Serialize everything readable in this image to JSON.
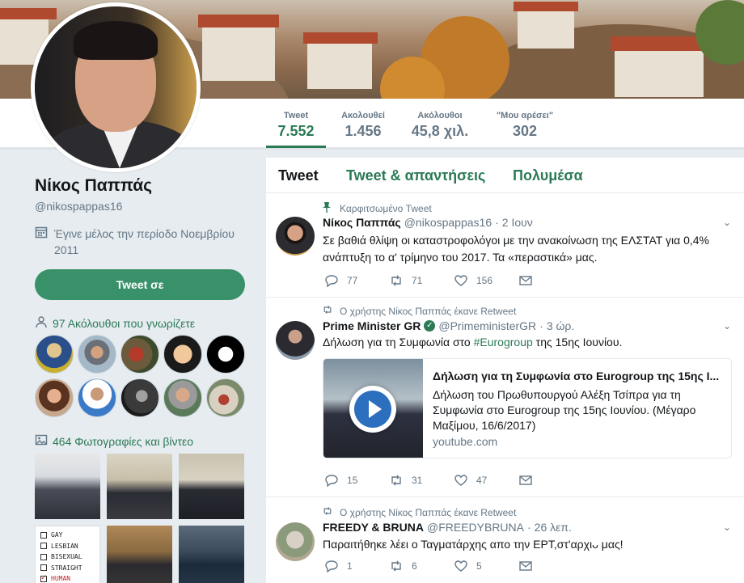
{
  "profile": {
    "name": "Νίκος Παππάς",
    "handle": "@nikospappas16",
    "joined": "Έγινε μέλος την περίοδο Νοεμβρίου 2011",
    "tweet_to_label": "Tweet σε",
    "followers_you_know": "97 Ακόλουθοι που γνωρίζετε",
    "photos_videos": "464 Φωτογραφίες και βίντεο"
  },
  "stats": [
    {
      "label": "Tweet",
      "value": "7.552"
    },
    {
      "label": "Ακολουθεί",
      "value": "1.456"
    },
    {
      "label": "Ακόλουθοι",
      "value": "45,8 χιλ."
    },
    {
      "label": "\"Μου αρέσει\"",
      "value": "302"
    }
  ],
  "tabs": [
    "Tweet",
    "Tweet & απαντήσεις",
    "Πολυμέσα"
  ],
  "thumb_list": [
    "GAY",
    "LESBIAN",
    "BISEXUAL",
    "STRAIGHT",
    "HUMAN"
  ],
  "tweets": [
    {
      "context": "Καρφιτσωμένο Tweet",
      "name": "Νίκος Παππάς",
      "handle": "@nikospappas16",
      "time": "2 Ιουν",
      "text": "Σε βαθιά θλίψη οι καταστροφολόγοι με την ανακοίνωση της ΕΛΣΤΑΤ για 0,4% ανάπτυξη το α' τρίμηνο του 2017. Τα «περαστικά» μας.",
      "replies": "77",
      "retweets": "71",
      "likes": "156"
    },
    {
      "context": "Ο χρήστης Νίκος Παππάς έκανε Retweet",
      "name": "Prime Minister GR",
      "handle": "@PrimeministerGR",
      "time": "3 ώρ.",
      "text_before": "Δήλωση για τη Συμφωνία στο ",
      "hashtag": "#Eurogroup",
      "text_after": " της 15ης Ιουνίου.",
      "card_title": "Δήλωση για τη Συμφωνία στο Eurogroup της 15ης Ι...",
      "card_desc": "Δήλωση του Πρωθυπουργού Αλέξη Τσίπρα για τη Συμφωνία στο Eurogroup της 15ης Ιουνίου. (Μέγαρο Μαξίμου, 16/6/2017)",
      "card_url": "youtube.com",
      "replies": "15",
      "retweets": "31",
      "likes": "47"
    },
    {
      "context": "Ο χρήστης Νίκος Παππάς έκανε Retweet",
      "name": "FREEDY & BRUNA",
      "handle": "@FREEDYBRUNA",
      "time": "26 λεπ.",
      "text": "Παραιτήθηκε λέει ο Ταγματάρχης απο την ΕΡΤ,στ'αρχιᴗ   μας!",
      "replies": "1",
      "retweets": "6",
      "likes": "5"
    }
  ],
  "icons": {
    "pin": "pin-icon",
    "retweet": "retweet-icon",
    "reply": "reply-icon",
    "like": "heart-icon",
    "dm": "envelope-icon",
    "calendar": "calendar-icon",
    "people": "people-icon",
    "photo": "photo-icon",
    "caret": "chevron-down-icon",
    "verified": "verified-icon"
  },
  "colors": {
    "accent": "#2b7a56",
    "button": "#39916a",
    "muted": "#657786",
    "background": "#e6ecf0"
  }
}
